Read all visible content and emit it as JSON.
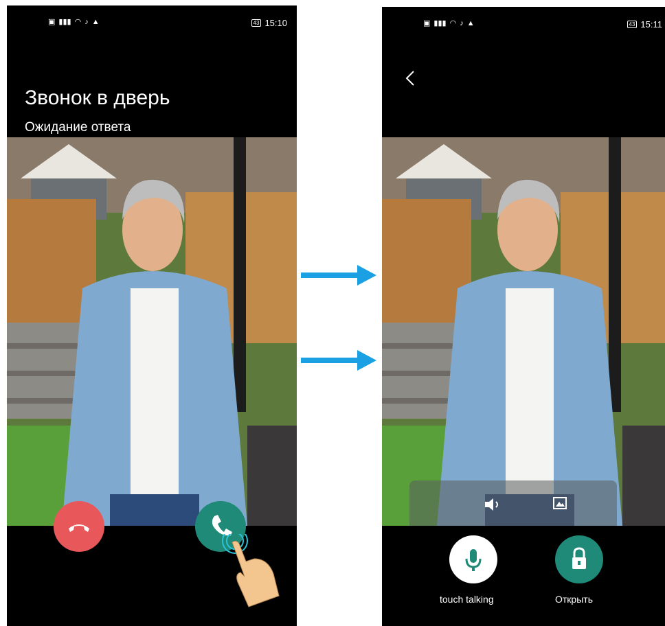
{
  "left_screen": {
    "status": {
      "battery": "43",
      "time": "15:10"
    },
    "title": "Звонок в дверь",
    "subtitle": "Ожидание ответа",
    "reject_icon": "phone-hangup-icon",
    "accept_icon": "phone-answer-icon"
  },
  "right_screen": {
    "status": {
      "battery": "43",
      "time": "15:11"
    },
    "back_icon": "chevron-left-icon",
    "toolbar": {
      "speaker_icon": "speaker-icon",
      "snapshot_icon": "snapshot-icon"
    },
    "talk_label": "touch talking",
    "open_label": "Открыть"
  },
  "colors": {
    "reject": "#e8575a",
    "accept": "#1f8a78",
    "arrow": "#1aa0e3",
    "background": "#000000"
  }
}
